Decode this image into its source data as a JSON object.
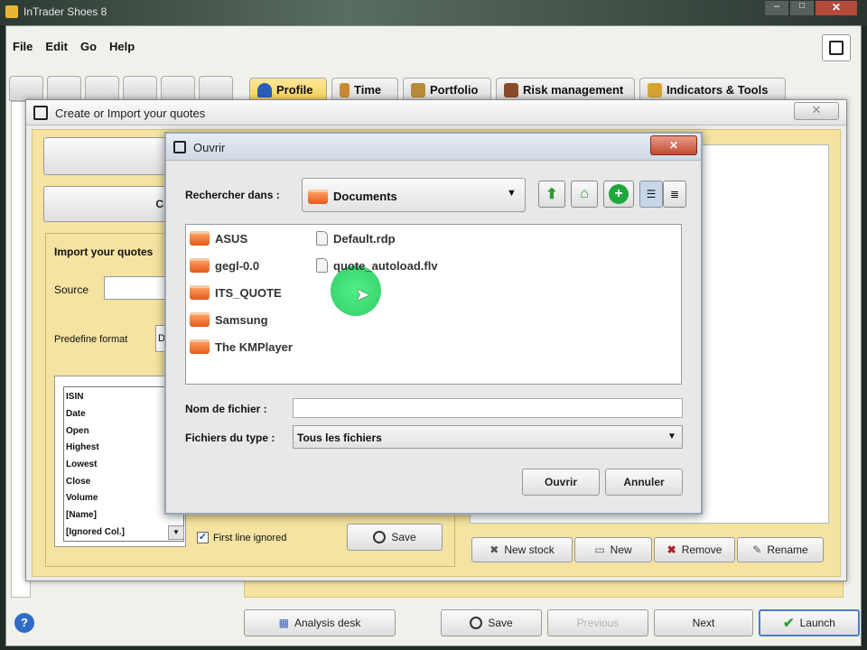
{
  "app": {
    "title": "InTrader Shoes 8"
  },
  "menu": {
    "items": [
      "File",
      "Edit",
      "Go",
      "Help"
    ]
  },
  "tabs": [
    {
      "label": "Profile",
      "icon": "user-icon"
    },
    {
      "label": "Time",
      "icon": "hourglass-icon"
    },
    {
      "label": "Portfolio",
      "icon": "briefcase-icon"
    },
    {
      "label": "Risk management",
      "icon": "scales-icon"
    },
    {
      "label": "Indicators & Tools",
      "icon": "indicators-icon"
    }
  ],
  "create_dialog": {
    "title": "Create or Import your quotes",
    "create_label": "Crea",
    "import_heading": "Import your quotes",
    "source_label": "Source",
    "predefine_label": "Predefine format",
    "predefine_value": "D",
    "fields": [
      "ISIN",
      "Date",
      "Open",
      "Highest",
      "Lowest",
      "Close",
      "Volume",
      "[Name]",
      "[Ignored Col.]"
    ],
    "first_line_label": "First line ignored",
    "first_line_checked": true,
    "save_label": "Save",
    "stock_buttons": [
      "New stock",
      "New",
      "Remove",
      "Rename"
    ]
  },
  "open_dialog": {
    "title": "Ouvrir",
    "look_in_label": "Rechercher dans :",
    "look_in_value": "Documents",
    "folders": [
      "ASUS",
      "gegl-0.0",
      "ITS_QUOTE",
      "Samsung",
      "The KMPlayer"
    ],
    "files": [
      "Default.rdp",
      "quote_autoload.flv"
    ],
    "filename_label": "Nom de fichier :",
    "filename_value": "",
    "filetype_label": "Fichiers du type :",
    "filetype_value": "Tous les fichiers",
    "open_label": "Ouvrir",
    "cancel_label": "Annuler"
  },
  "bottom": {
    "analysis_label": "Analysis desk",
    "save_label": "Save",
    "previous_label": "Previous",
    "next_label": "Next",
    "launch_label": "Launch"
  },
  "colors": {
    "accent_yellow": "#f6cf55",
    "panel_yellow": "#f4e3a1",
    "cursor_highlight": "#2ce06a"
  }
}
